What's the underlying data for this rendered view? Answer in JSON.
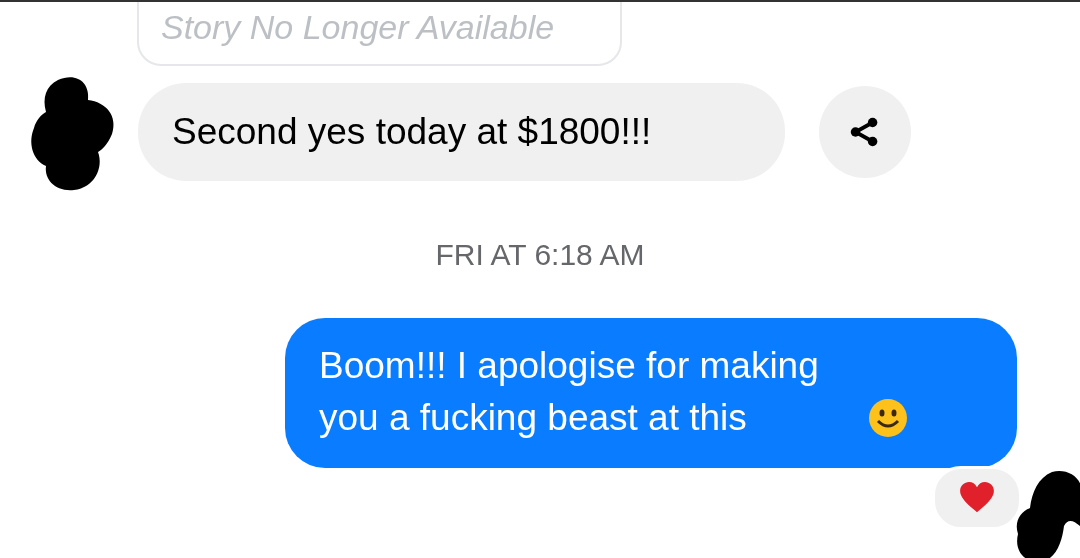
{
  "story_reply": {
    "text": "Story No Longer Available"
  },
  "incoming": {
    "text": "Second yes today at $1800!!!"
  },
  "timestamp": "FRI AT 6:18 AM",
  "outgoing": {
    "text": "Boom!!! I apologise for making you a fucking beast at this",
    "emoji": {
      "kind": "smile"
    },
    "reaction": {
      "kind": "heart"
    }
  }
}
